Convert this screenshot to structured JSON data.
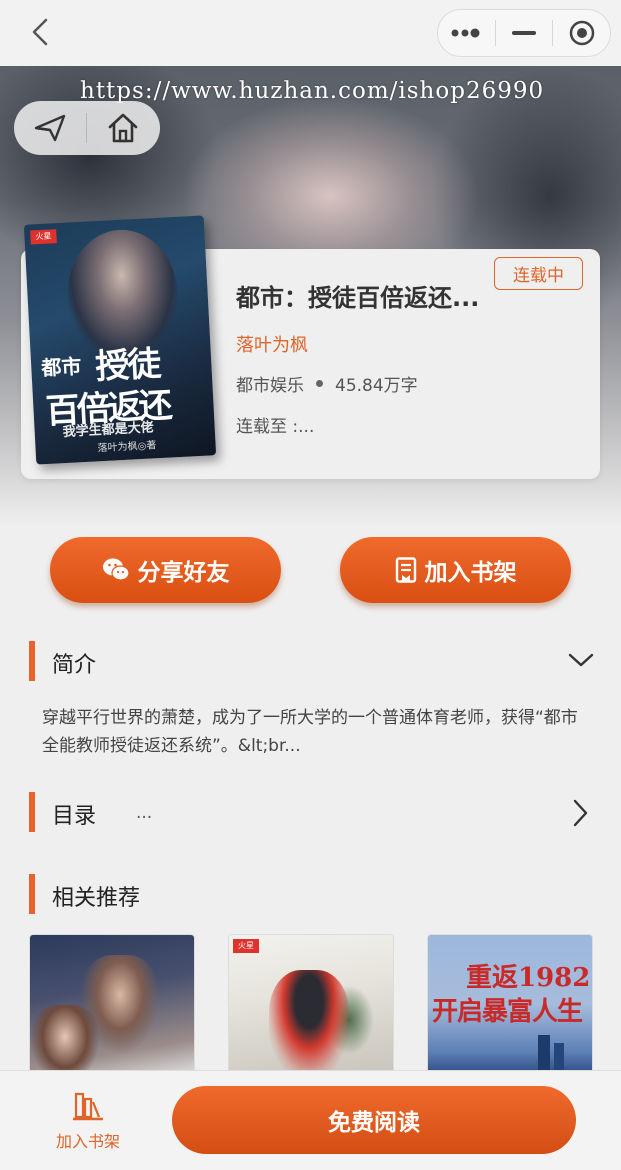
{
  "top_bar": {
    "back_icon": "chevron-left-icon",
    "capsule_icons": [
      "more-dots-icon",
      "minimize-icon",
      "target-circle-icon"
    ]
  },
  "watermark": "https://www.huzhan.com/ishop26990",
  "nav_pill": {
    "icons": [
      "share-arrow-icon",
      "home-icon"
    ]
  },
  "book": {
    "title": "都市：授徒百倍返还...",
    "status": "连载中",
    "author": "落叶为枫",
    "category": "都市娱乐",
    "word_count": "45.84万字",
    "update_text": "连载至 :...",
    "cover": {
      "badge": "火星",
      "title_a": "都市",
      "title_b": "授徒",
      "title_c": "百倍返还",
      "subtitle": "我学生都是大佬",
      "author_line": "落叶为枫◎著"
    }
  },
  "actions": {
    "share_label": "分享好友",
    "shelf_label": "加入书架"
  },
  "intro": {
    "heading": "简介",
    "text": "穿越平行世界的萧楚，成为了一所大学的一个普通体育老师，获得“都市全能教师授徒返还系统”。&lt;br..."
  },
  "toc": {
    "heading": "目录",
    "preview": "..."
  },
  "recommend": {
    "heading": "相关推荐",
    "items": [
      {
        "cover_text_1": "",
        "cover_text_2": ""
      },
      {
        "badge": "火星",
        "cover_text_1": "",
        "cover_text_2": ""
      },
      {
        "cover_text_1": "重返1982",
        "cover_text_2": "开启暴富人生"
      }
    ]
  },
  "bottom": {
    "shelf_label": "加入书架",
    "read_label": "免费阅读"
  },
  "colors": {
    "accent": "#e0652b",
    "button_gradient_top": "#ef6a2c",
    "button_gradient_bottom": "#d94f12"
  }
}
